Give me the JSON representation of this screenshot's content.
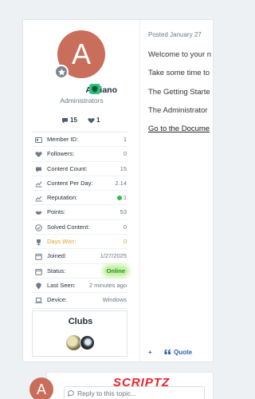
{
  "author": {
    "avatar_letter": "A",
    "name": "Adriano",
    "group": "Administrators",
    "comments_count": "15",
    "likes_count": "1"
  },
  "info": {
    "member_id_label": "Member ID:",
    "member_id": "1",
    "followers_label": "Followers:",
    "followers": "0",
    "content_count_label": "Content Count:",
    "content_count": "15",
    "content_per_day_label": "Content Per Day:",
    "content_per_day": "2.14",
    "reputation_label": "Reputation:",
    "reputation": "1",
    "points_label": "Points:",
    "points": "53",
    "solved_label": "Solved Content:",
    "solved": "0",
    "days_won_label": "Days Won:",
    "days_won": "0",
    "joined_label": "Joined:",
    "joined": "1/27/2025",
    "status_label": "Status:",
    "status": "Online",
    "last_seen_label": "Last Seen:",
    "last_seen": "2 minutes ago",
    "device_label": "Device:",
    "device": "Windows"
  },
  "clubs": {
    "title": "Clubs"
  },
  "post": {
    "date": "Posted January 27",
    "p1": "Welcome to your n",
    "p2": "Take some time to",
    "p3": "The Getting Starte",
    "p4": "The Administrator",
    "p5": "Go to the Docume",
    "quote_label": "Quote",
    "add_label": "+"
  },
  "reply": {
    "avatar_letter": "A",
    "placeholder": "Reply to this topic..."
  },
  "watermark": "SCRIPTZ",
  "colors": {
    "avatar": "#c96e5b",
    "online": "#1b8f2e",
    "days_won": "#e0a02c",
    "accent": "#2a63b8"
  }
}
